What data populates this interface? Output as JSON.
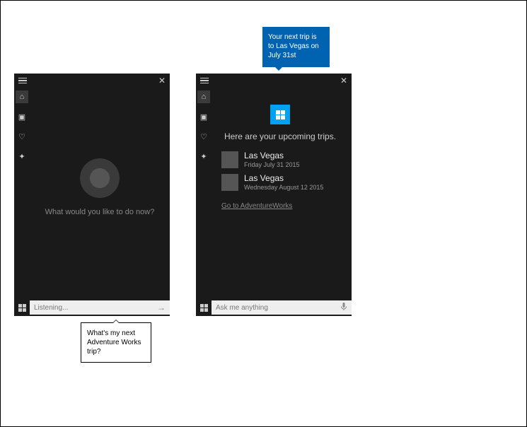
{
  "left": {
    "prompt": "What would you like to do now?",
    "input_text": "Listening...",
    "send_icon": "→"
  },
  "right": {
    "headline": "Here are your upcoming trips.",
    "trips": [
      {
        "title": "Las Vegas",
        "date": "Friday July 31 2015"
      },
      {
        "title": "Las Vegas",
        "date": "Wednesday August 12 2015"
      }
    ],
    "deeplink": "Go to AdventureWorks",
    "input_placeholder": "Ask me anything",
    "mic_icon": "🎤"
  },
  "callouts": {
    "user": "What's my next Adventure Works trip?",
    "cortana": "Your next trip is to Las Vegas on July 31st"
  },
  "close_label": "✕"
}
